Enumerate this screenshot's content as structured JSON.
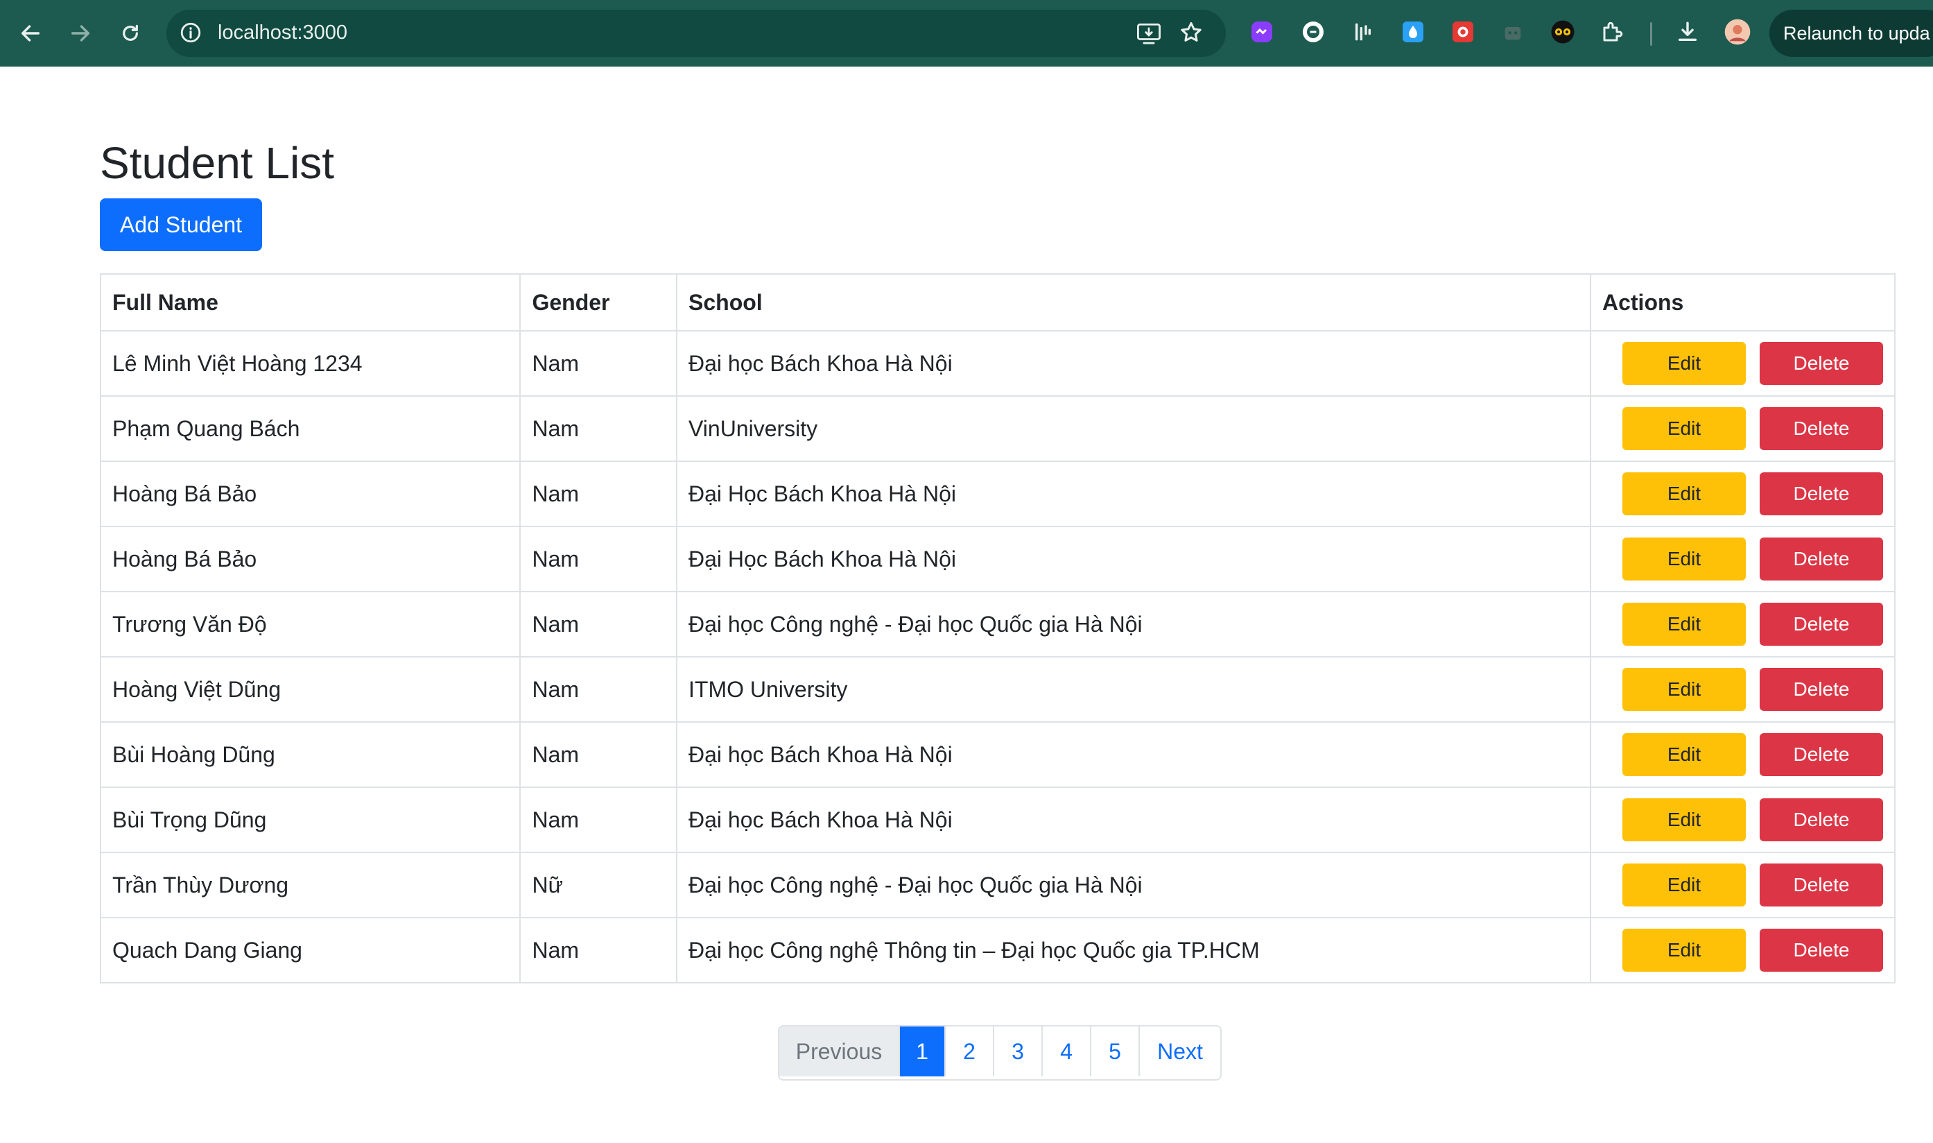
{
  "browser": {
    "url": "localhost:3000",
    "relaunch_label": "Relaunch to upda"
  },
  "page": {
    "title": "Student List",
    "add_button": "Add Student"
  },
  "table": {
    "headers": [
      "Full Name",
      "Gender",
      "School",
      "Actions"
    ],
    "edit_label": "Edit",
    "delete_label": "Delete",
    "rows": [
      {
        "name": "Lê Minh Việt Hoàng 1234",
        "gender": "Nam",
        "school": "Đại học Bách Khoa Hà Nội"
      },
      {
        "name": "Phạm Quang Bách",
        "gender": "Nam",
        "school": "VinUniversity"
      },
      {
        "name": "Hoàng Bá Bảo",
        "gender": "Nam",
        "school": "Đại Học Bách Khoa Hà Nội"
      },
      {
        "name": "Hoàng Bá Bảo",
        "gender": "Nam",
        "school": "Đại Học Bách Khoa Hà Nội"
      },
      {
        "name": "Trương Văn Độ",
        "gender": "Nam",
        "school": "Đại học Công nghệ - Đại học Quốc gia Hà Nội"
      },
      {
        "name": "Hoàng Việt Dũng",
        "gender": "Nam",
        "school": "ITMO University"
      },
      {
        "name": "Bùi Hoàng Dũng",
        "gender": "Nam",
        "school": "Đại học Bách Khoa Hà Nội"
      },
      {
        "name": "Bùi Trọng Dũng",
        "gender": "Nam",
        "school": "Đại học Bách Khoa Hà Nội"
      },
      {
        "name": "Trần Thùy Dương",
        "gender": "Nữ",
        "school": "Đại học Công nghệ - Đại học Quốc gia Hà Nội"
      },
      {
        "name": "Quach Dang Giang",
        "gender": "Nam",
        "school": "Đại học Công nghệ Thông tin – Đại học Quốc gia TP.HCM"
      }
    ]
  },
  "pagination": {
    "previous": "Previous",
    "pages": [
      "1",
      "2",
      "3",
      "4",
      "5"
    ],
    "active_page": "1",
    "next": "Next"
  },
  "colors": {
    "chrome_bg": "#1d5a50",
    "primary": "#0d6efd",
    "warning": "#ffc107",
    "danger": "#dc3545"
  }
}
